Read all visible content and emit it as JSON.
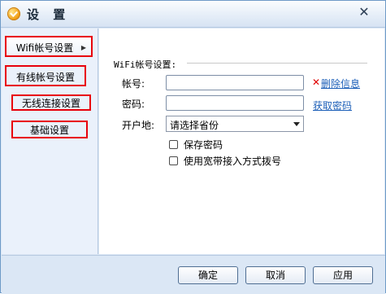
{
  "window": {
    "title": "设 置",
    "close_label": "✕"
  },
  "sidebar": {
    "items": [
      {
        "label": "Wifi帐号设置"
      },
      {
        "label": "有线帐号设置"
      },
      {
        "label": "无线连接设置"
      },
      {
        "label": "基础设置"
      }
    ]
  },
  "form": {
    "section_title": "WiFi帐号设置:",
    "account_label": "帐号:",
    "account_value": "",
    "password_label": "密码:",
    "password_value": "",
    "delete_link": "删除信息",
    "get_password_link": "获取密码",
    "region_label": "开户地:",
    "region_selected": "请选择省份",
    "save_password_label": "保存密码",
    "broadband_label": "使用宽带接入方式拨号"
  },
  "buttons": {
    "ok": "确定",
    "cancel": "取消",
    "apply": "应用"
  }
}
